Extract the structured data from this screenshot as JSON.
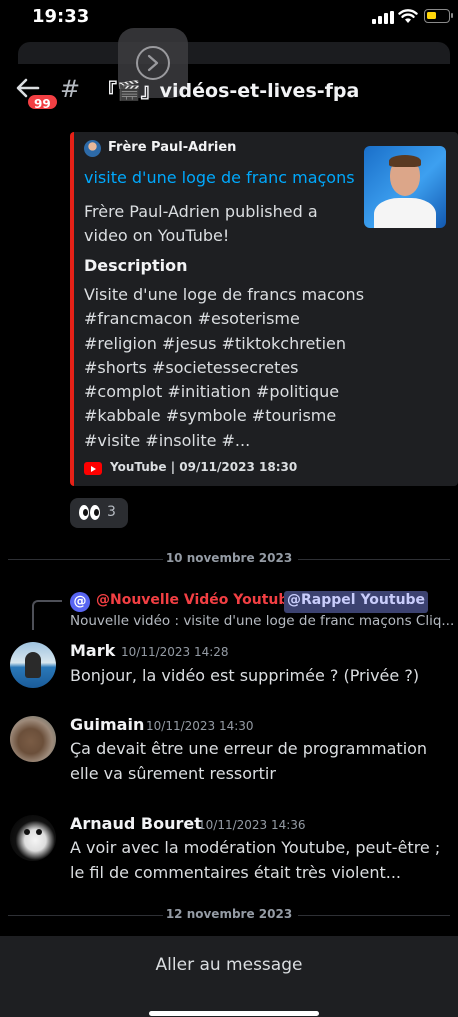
{
  "status_bar": {
    "time": "19:33"
  },
  "header": {
    "unread_count": "99",
    "channel_name": "『🎬』vidéos-et-lives-fpa"
  },
  "embed": {
    "author": "Frère Paul-Adrien",
    "title": "visite d'une loge de franc maçons",
    "description": "Frère Paul-Adrien published a video on YouTube!",
    "field_name": "Description",
    "field_value": "Visite d'une loge de francs macons\n#francmacon #esoterisme\n#religion #jesus #tiktokchretien\n#shorts #societessecretes\n#complot #initiation #politique\n#kabbale #symbole #tourisme\n#visite #insolite #...",
    "footer": "YouTube | 09/11/2023 18:30",
    "accent_color": "#e62117"
  },
  "reaction": {
    "emoji": "eyes",
    "count": "3"
  },
  "dividers": {
    "first": "10 novembre 2023",
    "second": "12 novembre 2023"
  },
  "reply": {
    "mention_1": "@Nouvelle Vidéo Youtube",
    "mention_2": "@Rappel Youtube",
    "preview": "Nouvelle vidéo : visite d'une loge de franc maçons Cliq..."
  },
  "messages": [
    {
      "author": "Mark",
      "timestamp": "10/11/2023 14:28",
      "content": "Bonjour, la vidéo est supprimée ? (Privée ?)"
    },
    {
      "author": "Guimain",
      "timestamp": "10/11/2023 14:30",
      "content": "Ça devait être une erreur de programmation elle va sûrement ressortir"
    },
    {
      "author": "Arnaud Bouret",
      "timestamp": "10/11/2023 14:36",
      "content": "A voir avec la modération Youtube, peut-être ; le fil de commentaires était très violent..."
    }
  ],
  "bottom_bar": {
    "label": "Aller au message"
  },
  "colors": {
    "link": "#00a8fc",
    "mention_red": "#f23f43",
    "badge": "#f23f43",
    "mention_pill_bg": "#3c4270"
  }
}
